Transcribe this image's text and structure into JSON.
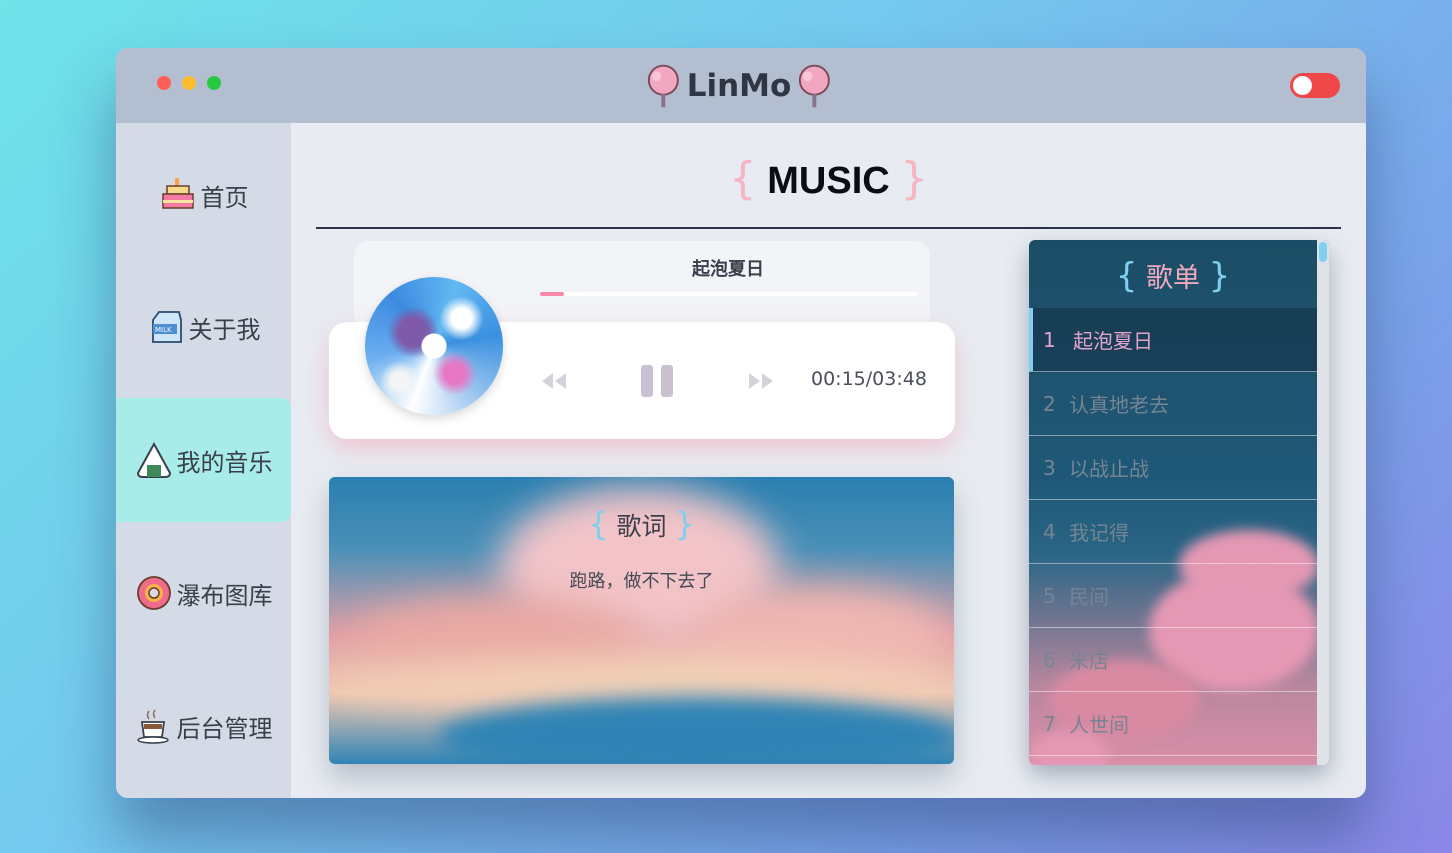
{
  "window": {
    "logo_text": "LinMo",
    "traffic_lights": [
      "#ff5f57",
      "#febc2e",
      "#28c840"
    ],
    "theme_toggle_color": "#f04848"
  },
  "sidebar": {
    "items": [
      {
        "label": "首页",
        "icon": "cake-icon",
        "active": false
      },
      {
        "label": "关于我",
        "icon": "milk-carton-icon",
        "active": false
      },
      {
        "label": "我的音乐",
        "icon": "onigiri-icon",
        "active": true
      },
      {
        "label": "瀑布图库",
        "icon": "donut-icon",
        "active": false
      },
      {
        "label": "后台管理",
        "icon": "coffee-cup-icon",
        "active": false
      }
    ]
  },
  "main": {
    "title": "MUSIC",
    "brace_open": "{",
    "brace_close": "}"
  },
  "player": {
    "song": "起泡夏日",
    "progress": 0.063,
    "time": "00:15/03:48",
    "state": "playing",
    "accent": "#f48aa8"
  },
  "lyrics": {
    "title": "歌词",
    "line": "跑路，做不下去了"
  },
  "playlist": {
    "title": "歌单",
    "songs": [
      {
        "num": "1",
        "name": "起泡夏日",
        "current": true
      },
      {
        "num": "2",
        "name": "认真地老去",
        "current": false
      },
      {
        "num": "3",
        "name": "以战止战",
        "current": false
      },
      {
        "num": "4",
        "name": "我记得",
        "current": false
      },
      {
        "num": "5",
        "name": "民间",
        "current": false
      },
      {
        "num": "6",
        "name": "米店",
        "current": false
      },
      {
        "num": "7",
        "name": "人世间",
        "current": false
      }
    ]
  }
}
